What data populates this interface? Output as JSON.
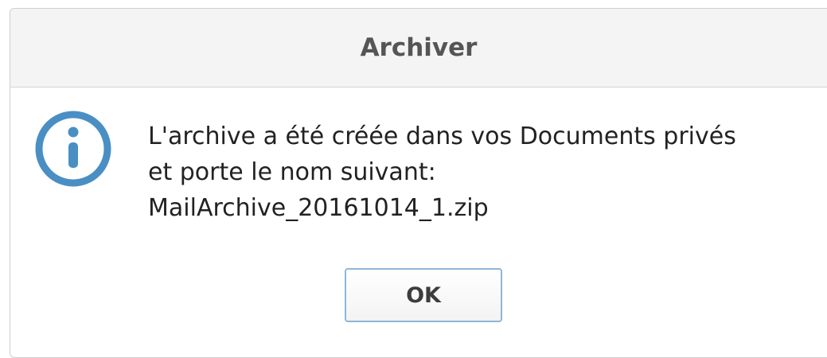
{
  "dialog": {
    "title": "Archiver",
    "icon": "info-icon",
    "message_lines": [
      "L'archive a été créée dans vos Documents privés",
      "et porte le nom suivant:",
      "MailArchive_20161014_1.zip"
    ],
    "ok_label": "OK"
  },
  "colors": {
    "icon_blue": "#4a8fc4",
    "button_border": "#8fb6d8",
    "titlebar_bg": "#f4f4f4"
  }
}
